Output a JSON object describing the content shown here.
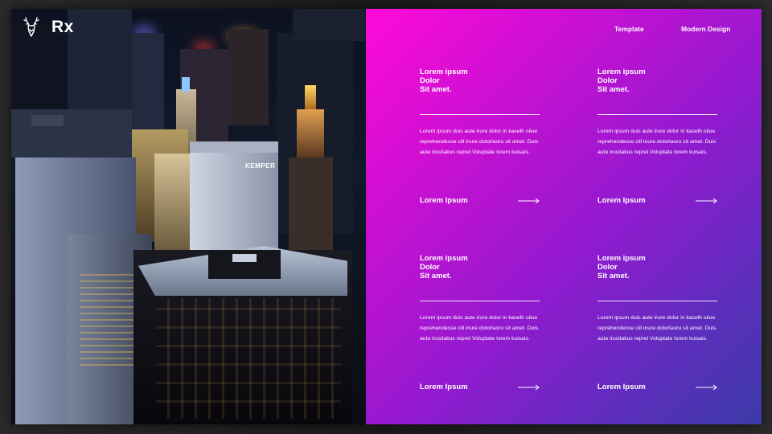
{
  "brand": {
    "name": "Rx",
    "icon": "deer-head-icon"
  },
  "nav": {
    "template": "Template",
    "modern_design": "Modern Design"
  },
  "photo": {
    "building_sign": "KEMPER"
  },
  "cards": [
    {
      "title_line1": "Lorem ipsum",
      "title_line2": "Dolor",
      "title_line3": "Sit amet.",
      "body": "Lorem  ipsum duis aute irure dolor in kaselh oiiue reprehendesse cill inure dolorlaoru sit amet. Duis aute irusitakus reprel Voluptate lorem kuisais.",
      "link_label": "Lorem Ipsum",
      "link_icon": "arrow-right-icon"
    },
    {
      "title_line1": "Lorem ipsum",
      "title_line2": "Dolor",
      "title_line3": "Sit amet.",
      "body": "Lorem  ipsum duis aute irure dolor in kaselh oiiue reprehendesse cill inure dolorlaoru sit amet. Duis aute irusitakus reprel Voluptate lorem kuisais.",
      "link_label": "Lorem Ipsum",
      "link_icon": "arrow-right-icon"
    },
    {
      "title_line1": "Lorem ipsum",
      "title_line2": "Dolor",
      "title_line3": "Sit amet.",
      "body": "Lorem  ipsum duis aute irure dolor in kaselh oiiue reprehendesse cill inure dolorlaoru sit amet. Duis aute irusitakus reprel Voluptate lorem kuisais.",
      "link_label": "Lorem Ipsum",
      "link_icon": "arrow-right-icon"
    },
    {
      "title_line1": "Lorem ipsum",
      "title_line2": "Dolor",
      "title_line3": "Sit amet.",
      "body": "Lorem  ipsum duis aute irure dolor in kaselh oiiue reprehendesse cill inure dolorlaoru sit amet. Duis aute irusitakus reprel Voluptate lorem kuisais.",
      "link_label": "Lorem Ipsum",
      "link_icon": "arrow-right-icon"
    }
  ],
  "colors": {
    "gradient_start": "#ff0ad8",
    "gradient_mid": "#8e1bcf",
    "gradient_end": "#3c3aa8",
    "text": "#ffffff"
  }
}
